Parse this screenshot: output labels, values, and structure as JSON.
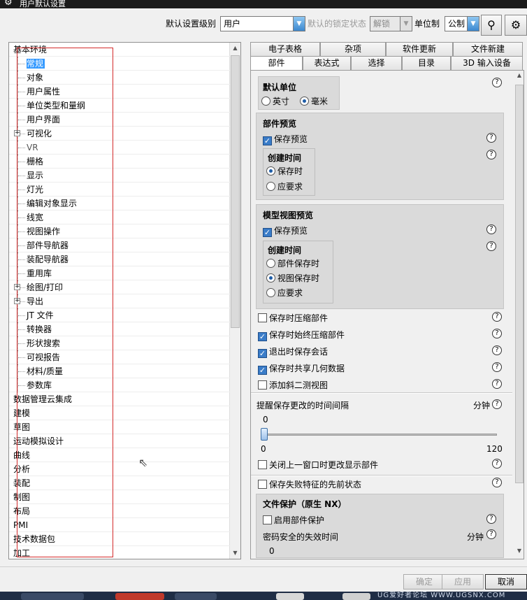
{
  "window": {
    "title": "用户默认设置"
  },
  "toolbar": {
    "level_label": "默认设置级别",
    "level_value": "用户",
    "lock_label": "默认的锁定状态",
    "lock_value": "解锁",
    "unit_label": "单位制",
    "unit_value": "公制",
    "binoculars_icon": "binoculars-icon",
    "settings_icon": "gear-icon"
  },
  "tree": {
    "items": [
      {
        "label": "基本环境",
        "level": 0
      },
      {
        "label": "常规",
        "level": 1,
        "selected": true
      },
      {
        "label": "对象",
        "level": 1
      },
      {
        "label": "用户属性",
        "level": 1
      },
      {
        "label": "单位类型和量纲",
        "level": 1
      },
      {
        "label": "用户界面",
        "level": 1
      },
      {
        "label": "可视化",
        "level": 1,
        "expandable": true
      },
      {
        "label": "VR",
        "level": 1,
        "grey": true
      },
      {
        "label": "栅格",
        "level": 1
      },
      {
        "label": "显示",
        "level": 1
      },
      {
        "label": "灯光",
        "level": 1
      },
      {
        "label": "编辑对象显示",
        "level": 1
      },
      {
        "label": "线宽",
        "level": 1
      },
      {
        "label": "视图操作",
        "level": 1
      },
      {
        "label": "部件导航器",
        "level": 1
      },
      {
        "label": "装配导航器",
        "level": 1
      },
      {
        "label": "重用库",
        "level": 1
      },
      {
        "label": "绘图/打印",
        "level": 1,
        "expandable": true
      },
      {
        "label": "导出",
        "level": 1,
        "expandable": true
      },
      {
        "label": "JT 文件",
        "level": 1
      },
      {
        "label": "转换器",
        "level": 1
      },
      {
        "label": "形状搜索",
        "level": 1
      },
      {
        "label": "可视报告",
        "level": 1
      },
      {
        "label": "材料/质量",
        "level": 1
      },
      {
        "label": "参数库",
        "level": 1
      },
      {
        "label": "数据管理云集成",
        "level": 0
      },
      {
        "label": "建模",
        "level": 0
      },
      {
        "label": "草图",
        "level": 0
      },
      {
        "label": "运动模拟设计",
        "level": 0
      },
      {
        "label": "曲线",
        "level": 0
      },
      {
        "label": "分析",
        "level": 0
      },
      {
        "label": "装配",
        "level": 0
      },
      {
        "label": "制图",
        "level": 0
      },
      {
        "label": "布局",
        "level": 0
      },
      {
        "label": "PMI",
        "level": 0
      },
      {
        "label": "技术数据包",
        "level": 0
      },
      {
        "label": "加工",
        "level": 0
      }
    ]
  },
  "tabs": {
    "row1": [
      "电子表格",
      "杂项",
      "软件更新",
      "文件新建"
    ],
    "row2": [
      "部件",
      "表达式",
      "选择",
      "目录",
      "3D 输入设备"
    ],
    "active": "部件"
  },
  "panel": {
    "units": {
      "title": "默认单位",
      "inch": "英寸",
      "mm": "毫米",
      "selected": "毫米"
    },
    "part_preview": {
      "title": "部件预览",
      "save_preview": "保存预览",
      "save_preview_checked": true,
      "create_time_title": "创建时间",
      "on_save": "保存时",
      "on_demand": "应要求",
      "selected": "保存时"
    },
    "model_view_preview": {
      "title": "模型视图预览",
      "save_preview": "保存预览",
      "save_preview_checked": true,
      "create_time_title": "创建时间",
      "part_save": "部件保存时",
      "view_save": "视图保存时",
      "on_demand": "应要求",
      "selected": "视图保存时"
    },
    "options": [
      {
        "label": "保存时压缩部件",
        "checked": false
      },
      {
        "label": "保存时始终压缩部件",
        "checked": true
      },
      {
        "label": "退出时保存会话",
        "checked": true
      },
      {
        "label": "保存时共享几何数据",
        "checked": true
      },
      {
        "label": "添加斜二测视图",
        "checked": false
      }
    ],
    "reminder": {
      "label": "提醒保存更改的时间间隔",
      "unit": "分钟",
      "value": "0",
      "min": "0",
      "max": "120",
      "fraction": 0
    },
    "close_window_option": {
      "label": "关闭上一窗口时更改显示部件",
      "checked": false
    },
    "save_failed_option": {
      "label": "保存失败特征的先前状态",
      "checked": false
    },
    "file_protection": {
      "title": "文件保护（原生 NX）",
      "enable_label": "启用部件保护",
      "enable_checked": false,
      "password_label": "密码安全的失效时间",
      "password_unit": "分钟",
      "password_value": "0"
    },
    "help_glyph": "?"
  },
  "buttons": {
    "ok": "确定",
    "apply": "应用",
    "cancel": "取消"
  },
  "watermark": "UG爱好者论坛 WWW.UGSNX.COM",
  "colors": {
    "selection": "#3399ff",
    "annotation_box": "#d42a2a",
    "checkbox_on": "#3a7cc8"
  }
}
